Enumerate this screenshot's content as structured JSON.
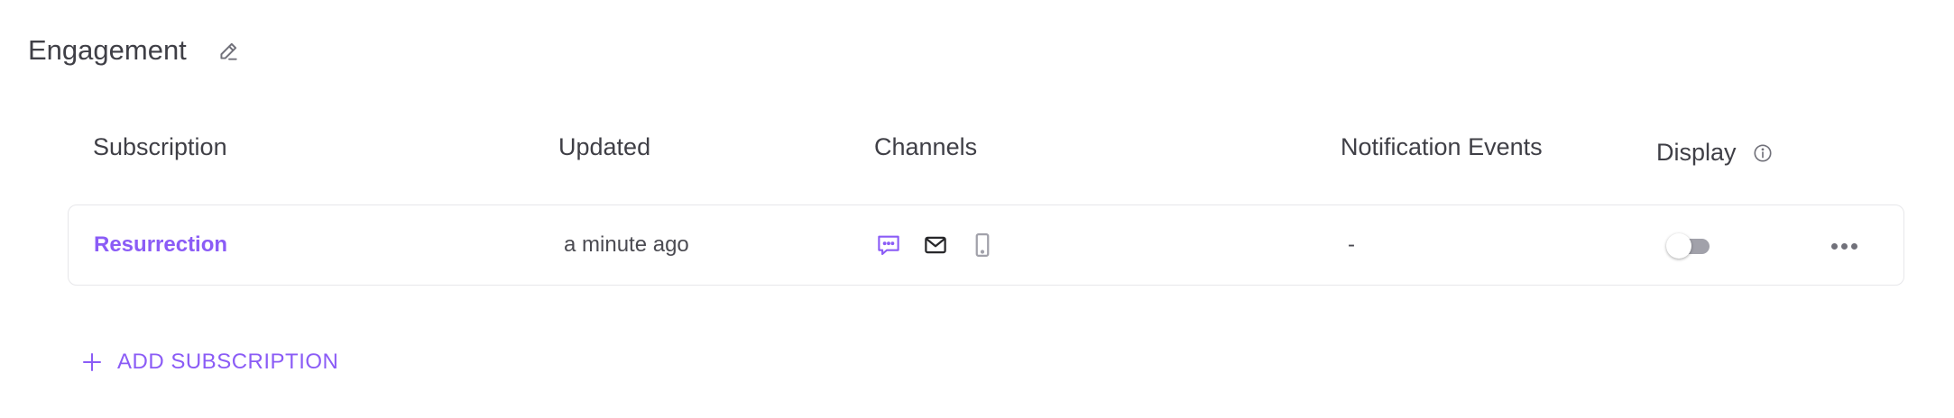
{
  "section": {
    "title": "Engagement"
  },
  "table": {
    "headers": {
      "subscription": "Subscription",
      "updated": "Updated",
      "channels": "Channels",
      "notification_events": "Notification Events",
      "display": "Display"
    },
    "rows": [
      {
        "name": "Resurrection",
        "updated": "a minute ago",
        "channels": [
          {
            "icon": "chat-icon",
            "color": "#8b5cf6"
          },
          {
            "icon": "mail-icon",
            "color": "#27272a"
          },
          {
            "icon": "mobile-icon",
            "color": "#a1a1aa"
          }
        ],
        "notification_events": "-",
        "display_enabled": false
      }
    ]
  },
  "actions": {
    "add_subscription_label": "ADD SUBSCRIPTION"
  },
  "colors": {
    "accent": "#8b5cf6",
    "text": "#3f3f46",
    "border": "#e7e7ea",
    "toggle_off": "#a1a1aa"
  }
}
